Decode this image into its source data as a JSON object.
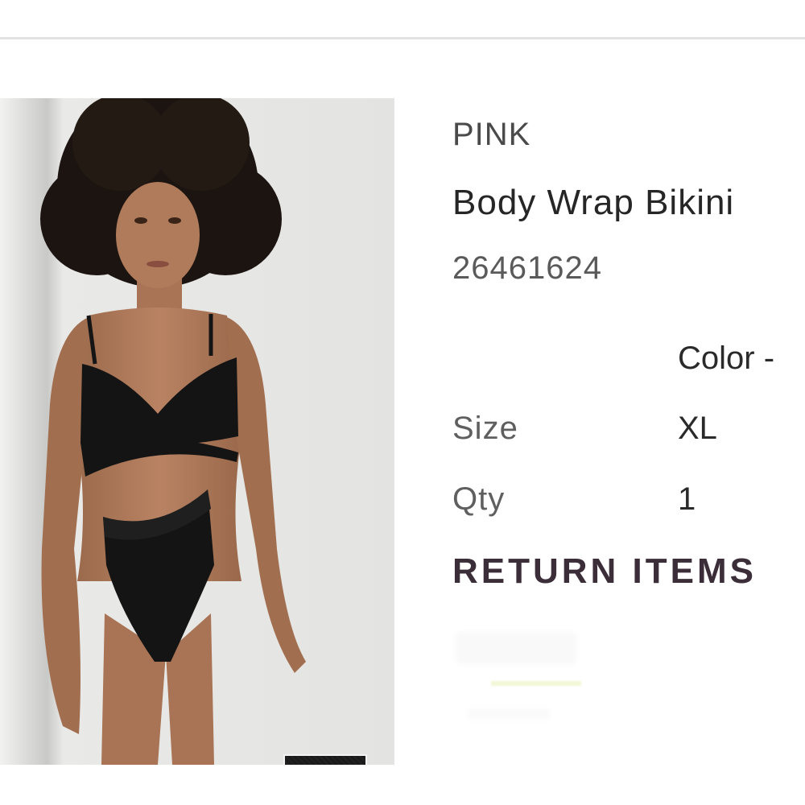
{
  "product": {
    "brand": "PINK",
    "name": "Body Wrap Bikini",
    "item_number": "26461624",
    "color_label": "Color -",
    "size_label": "Size",
    "size_value": "XL",
    "qty_label": "Qty",
    "qty_value": "1",
    "swatch_color": "#1a1a1a"
  },
  "actions": {
    "return_items_label": "RETURN ITEMS"
  },
  "colors": {
    "accent_text": "#3b2e38",
    "divider": "#e3e1e2"
  }
}
